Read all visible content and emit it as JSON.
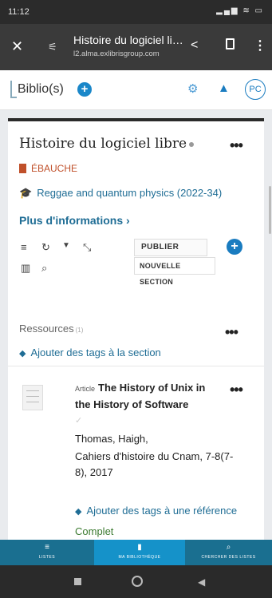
{
  "status_bar": {
    "time": "11:12",
    "icons": "▂▄▆ ≋ ▭"
  },
  "browser": {
    "close_glyph": "✕",
    "tune_glyph": "⚟",
    "page_title": "Histoire du logiciel libre",
    "url": "l2.alma.exlibrisgroup.com",
    "share_glyph": "<",
    "menu_glyph": "⋮"
  },
  "header": {
    "app_name": "Biblio(s)",
    "plus_glyph": "+",
    "gears_glyph": "⚙",
    "bell_glyph": "▲",
    "user_initials": "PC"
  },
  "list": {
    "title": "Histoire du logiciel libre",
    "more_glyph": "•••",
    "status": "ÉBAUCHE",
    "cap_glyph": "🎓",
    "course": "Reggae and quantum physics (2022-34)",
    "more_info": "Plus d'informations ›",
    "toolbar": {
      "list_glyph": "≡",
      "refresh_glyph": "↻",
      "filter_glyph": "▼",
      "collapse_glyph": "⤡",
      "chart_glyph": "▥",
      "search_glyph": "⌕",
      "publish": "PUBLIER",
      "new_section": "NOUVELLE SECTION",
      "add_glyph": "+"
    }
  },
  "section": {
    "name": "Ressources",
    "count": "(1)",
    "add_tags": "Ajouter des tags à la section",
    "tag_glyph": "◆"
  },
  "citation": {
    "type": "Article",
    "title": "The History of Unix in the History of Software",
    "check_glyph": "✓",
    "author": "Thomas, Haigh,",
    "source": "Cahiers d'histoire du Cnam, 7-8(7-8), 2017",
    "add_tags": "Ajouter des tags à une référence",
    "status": "Complet"
  },
  "bottom_nav": {
    "lists": {
      "icon": "≡",
      "label": "LISTES"
    },
    "library": {
      "icon": "▮",
      "label": "MA BIBLIOTHÈQUE"
    },
    "search": {
      "icon": "⌕",
      "label": "CHERCHER DES LISTES"
    }
  },
  "android_nav": {
    "back_glyph": "◀"
  }
}
